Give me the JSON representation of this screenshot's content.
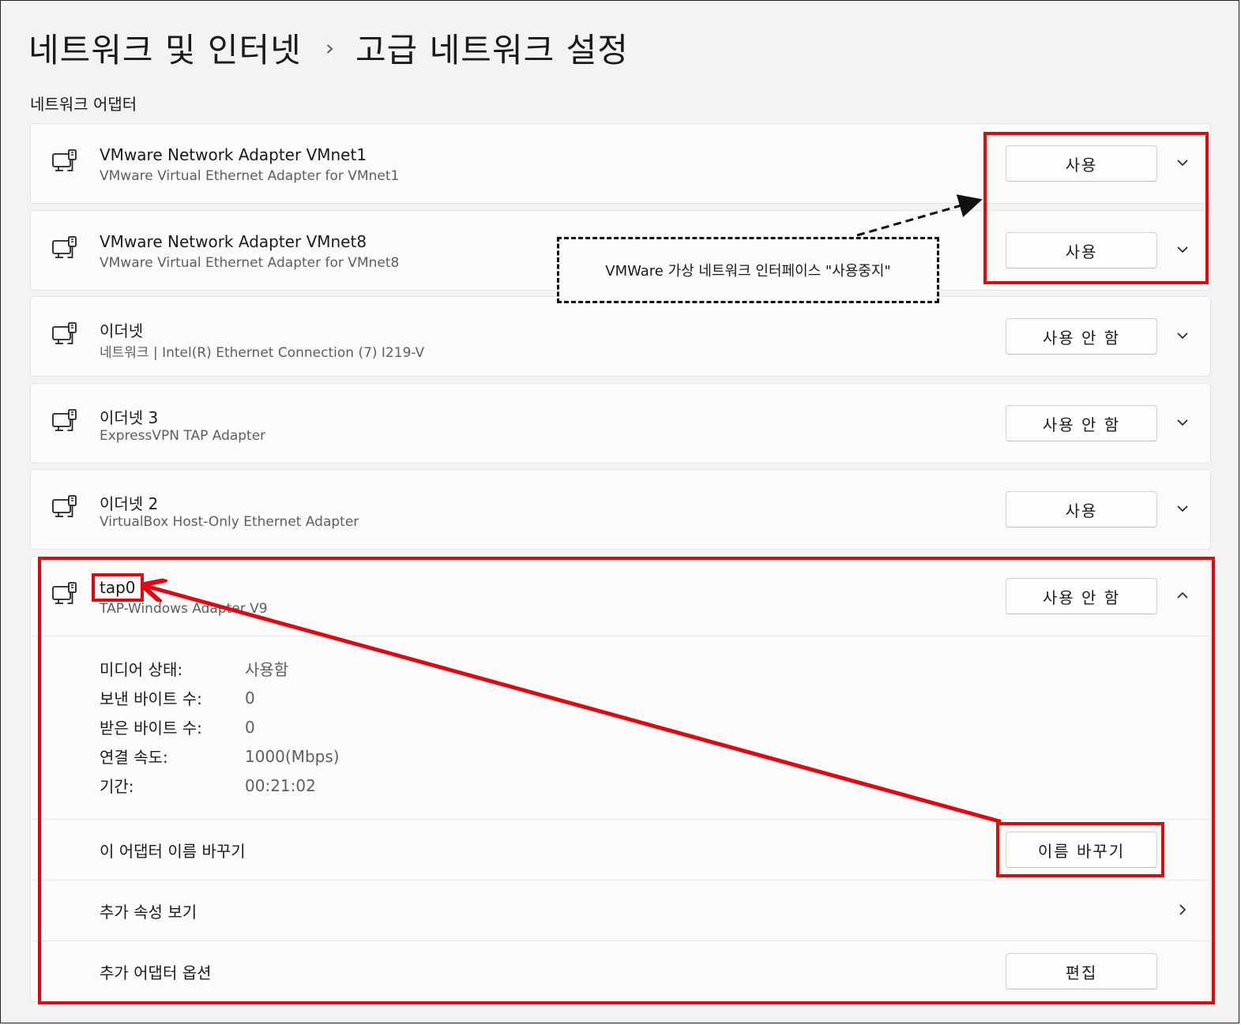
{
  "breadcrumb": {
    "parent": "네트워크 및 인터넷",
    "separator": "›",
    "current": "고급 네트워크 설정"
  },
  "section_title": "네트워크 어댑터",
  "adapters": [
    {
      "name": "VMware Network Adapter VMnet1",
      "description": "VMware Virtual Ethernet Adapter for VMnet1",
      "button": "사용",
      "icon": "network-adapter-icon"
    },
    {
      "name": "VMware Network Adapter VMnet8",
      "description": "VMware Virtual Ethernet Adapter for VMnet8",
      "button": "사용",
      "icon": "network-adapter-icon"
    },
    {
      "name": "이더넷",
      "description": "네트워크 | Intel(R) Ethernet Connection (7) I219-V",
      "button": "사용 안 함",
      "icon": "network-adapter-icon"
    },
    {
      "name": "이더넷 3",
      "description": "ExpressVPN TAP Adapter",
      "button": "사용 안 함",
      "icon": "network-adapter-icon"
    },
    {
      "name": "이더넷 2",
      "description": "VirtualBox Host-Only Ethernet Adapter",
      "button": "사용",
      "icon": "network-adapter-icon"
    },
    {
      "name": "tap0",
      "description": "TAP-Windows Adapter V9",
      "button": "사용 안 함",
      "icon": "network-adapter-icon"
    }
  ],
  "details": [
    {
      "label": "미디어 상태:",
      "value": "사용함"
    },
    {
      "label": "보낸 바이트 수:",
      "value": "0"
    },
    {
      "label": "받은 바이트 수:",
      "value": "0"
    },
    {
      "label": "연결 속도:",
      "value": "1000(Mbps)"
    },
    {
      "label": "기간:",
      "value": "00:21:02"
    }
  ],
  "rename_row": {
    "label": "이 어댑터 이름 바꾸기",
    "button": "이름 바꾸기"
  },
  "properties_row": {
    "label": "추가 속성 보기"
  },
  "options_row": {
    "label": "추가 어댑터 옵션",
    "button": "편집"
  },
  "annotation": {
    "text": "VMWare 가상 네트워크 인터페이스 \"사용중지\""
  },
  "colors": {
    "highlight": "#e0080f",
    "background": "#f3f3f3",
    "card": "#fbfbfb"
  }
}
